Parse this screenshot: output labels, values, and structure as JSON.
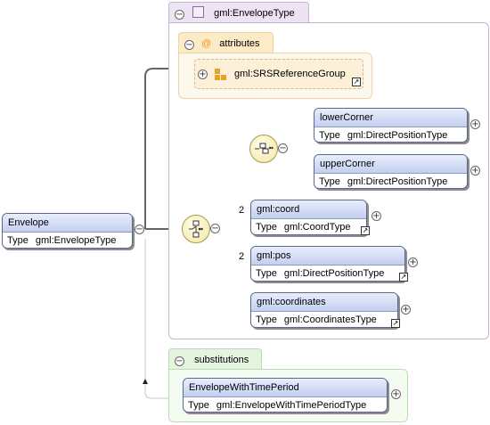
{
  "type_region": {
    "tab_label": "gml:EnvelopeType"
  },
  "attributes": {
    "tab_label": "attributes",
    "group": {
      "label": "gml:SRSReferenceGroup"
    }
  },
  "root": {
    "name": "Envelope",
    "type_key": "Type",
    "type_value": "gml:EnvelopeType"
  },
  "elements": {
    "lowerCorner": {
      "name": "lowerCorner",
      "type_key": "Type",
      "type_value": "gml:DirectPositionType"
    },
    "upperCorner": {
      "name": "upperCorner",
      "type_key": "Type",
      "type_value": "gml:DirectPositionType"
    },
    "coord": {
      "name": "gml:coord",
      "type_key": "Type",
      "type_value": "gml:CoordType",
      "count": "2"
    },
    "pos": {
      "name": "gml:pos",
      "type_key": "Type",
      "type_value": "gml:DirectPositionType",
      "count": "2"
    },
    "coordinates": {
      "name": "gml:coordinates",
      "type_key": "Type",
      "type_value": "gml:CoordinatesType"
    }
  },
  "substitutions": {
    "tab_label": "substitutions",
    "element": {
      "name": "EnvelopeWithTimePeriod",
      "type_key": "Type",
      "type_value": "gml:EnvelopeWithTimePeriodType"
    }
  },
  "colors": {
    "type_region": "#eee3f3",
    "attributes_region": "#fdebc8",
    "substitutions_region": "#e3f5df",
    "element_header": "#c3cff0"
  },
  "icons": {
    "collapse": "minus-circle-icon",
    "expand": "plus-circle-icon",
    "jump": "jump-arrow-icon",
    "attribute_marker": "at-icon",
    "group": "attribute-group-icon",
    "sequence": "sequence-compositor-icon",
    "choice": "choice-compositor-icon"
  }
}
